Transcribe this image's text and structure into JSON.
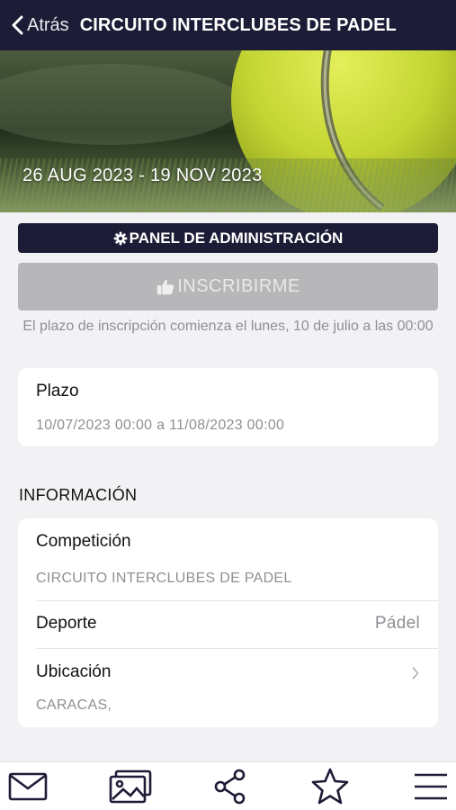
{
  "header": {
    "back_label": "Atrás",
    "title": "CIRCUITO INTERCLUBES DE PADEL"
  },
  "hero": {
    "dates": "26 AUG 2023 - 19 NOV 2023"
  },
  "actions": {
    "admin_label": "PANEL DE ADMINISTRACIÓN",
    "signup_label": "INSCRIBIRME",
    "notice": "El plazo de inscripción comienza el lunes, 10 de julio a las 00:00"
  },
  "plazo": {
    "title": "Plazo",
    "value": "10/07/2023 00:00 a 11/08/2023 00:00"
  },
  "info": {
    "section_title": "INFORMACIÓN",
    "competicion_label": "Competición",
    "competicion_value": "CIRCUITO INTERCLUBES DE PADEL",
    "deporte_label": "Deporte",
    "deporte_value": "Pádel",
    "ubicacion_label": "Ubicación",
    "ubicacion_value": "CARACAS,"
  },
  "tabbar": {
    "icons": [
      "mail-icon",
      "gallery-icon",
      "share-icon",
      "star-icon",
      "menu-icon"
    ]
  },
  "colors": {
    "navy": "#1d1c36",
    "disabled_button": "#b7b7ba",
    "muted_text": "#8f8f95",
    "ball": "#c8d93a"
  }
}
